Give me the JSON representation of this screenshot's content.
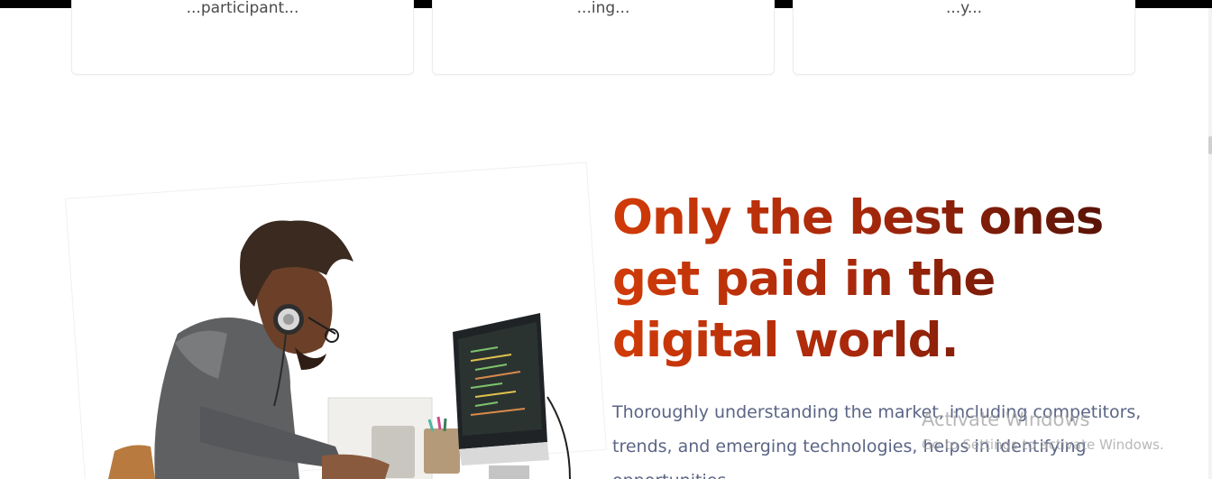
{
  "cards": [
    {
      "text": "...participant..."
    },
    {
      "text": "...ing..."
    },
    {
      "text": "...y..."
    }
  ],
  "hero": {
    "headline_lines": [
      "Only the best ones",
      "get paid in the",
      "digital world."
    ],
    "body": "Thoroughly understanding the market, including competitors, trends, and emerging technologies, helps in identifying opportunities."
  },
  "watermark": {
    "title": "Activate Windows",
    "subtitle": "Go to Settings to activate Windows."
  },
  "colors": {
    "headline_start": "#d13b08",
    "headline_end": "#4a0f06",
    "body_text": "#5b6585"
  }
}
